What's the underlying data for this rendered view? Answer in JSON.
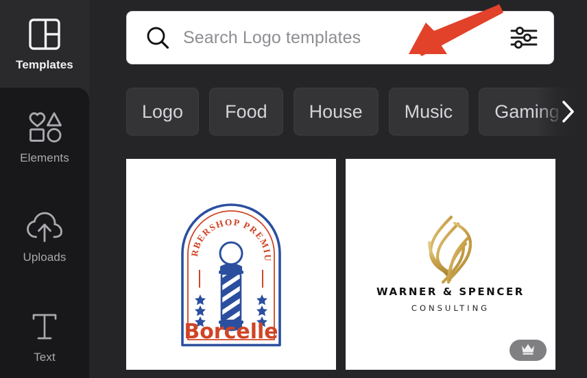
{
  "theme": {
    "sidebar_bg": "#18181a",
    "sidebar_active_bg": "#2a2a2d",
    "panel_bg": "#252528",
    "chip_bg": "#343437",
    "card_bg": "#ffffff",
    "annotation_arrow_color": "#e2412a",
    "accent_text": "#f3f3f4"
  },
  "sidebar": {
    "items": [
      {
        "label": "Templates",
        "icon": "templates-icon",
        "active": true
      },
      {
        "label": "Elements",
        "icon": "elements-icon",
        "active": false
      },
      {
        "label": "Uploads",
        "icon": "uploads-icon",
        "active": false
      },
      {
        "label": "Text",
        "icon": "text-icon",
        "active": false
      }
    ]
  },
  "search": {
    "placeholder": "Search Logo templates",
    "value": "",
    "search_icon": "search-icon",
    "filter_icon": "filter-sliders-icon"
  },
  "chips": {
    "next_icon": "chevron-right-icon",
    "items": [
      {
        "label": "Logo"
      },
      {
        "label": "Food"
      },
      {
        "label": "House"
      },
      {
        "label": "Music"
      },
      {
        "label": "Gaming"
      }
    ]
  },
  "templates": [
    {
      "name": "barbershop-premium-borcelle-logo",
      "arch_text": "BARBERSHOP PREMIUM",
      "brand": "Borcelle",
      "stars": 3,
      "colors": {
        "blue": "#2b4f9e",
        "red": "#cf4425"
      },
      "pro": false
    },
    {
      "name": "warner-spencer-consulting-logo",
      "brand": "WARNER & SPENCER",
      "subtitle": "CONSULTING",
      "colors": {
        "gold": "#c9a24a",
        "text": "#111111"
      },
      "pro": true,
      "pro_icon": "crown-icon"
    }
  ],
  "annotation": {
    "type": "arrow",
    "points_to": "search-input"
  }
}
